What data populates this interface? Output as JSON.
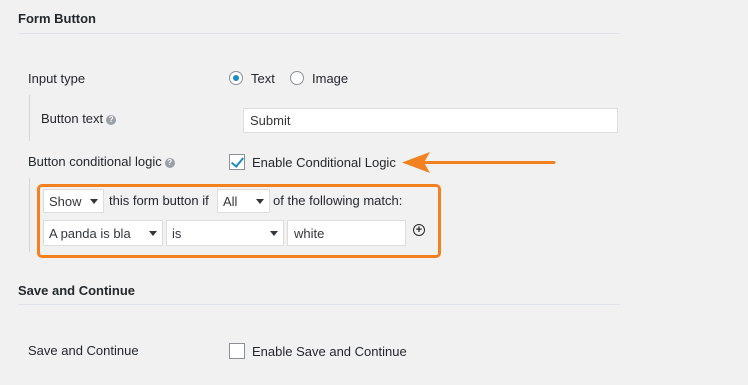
{
  "form_button": {
    "title": "Form Button",
    "input_type": {
      "label": "Input type",
      "options": [
        {
          "label": "Text",
          "selected": true
        },
        {
          "label": "Image",
          "selected": false
        }
      ]
    },
    "button_text": {
      "label": "Button text",
      "value": "Submit"
    },
    "conditional_logic": {
      "label": "Button conditional logic",
      "checkbox_label": "Enable Conditional Logic",
      "checked": true,
      "rule": {
        "action": "Show",
        "text_1": "this form button if",
        "match_type": "All",
        "text_2": "of the following match:",
        "field": "A panda is bla",
        "operator": "is",
        "value": "white"
      }
    }
  },
  "save_continue": {
    "title": "Save and Continue",
    "label": "Save and Continue",
    "checkbox_label": "Enable Save and Continue",
    "checked": false
  },
  "colors": {
    "highlight": "#f48120",
    "accent": "#1e8cbe"
  },
  "icons": {
    "help": "question-circle-icon",
    "add_rule": "plus-circle-icon",
    "arrow": "arrow-left-icon"
  }
}
